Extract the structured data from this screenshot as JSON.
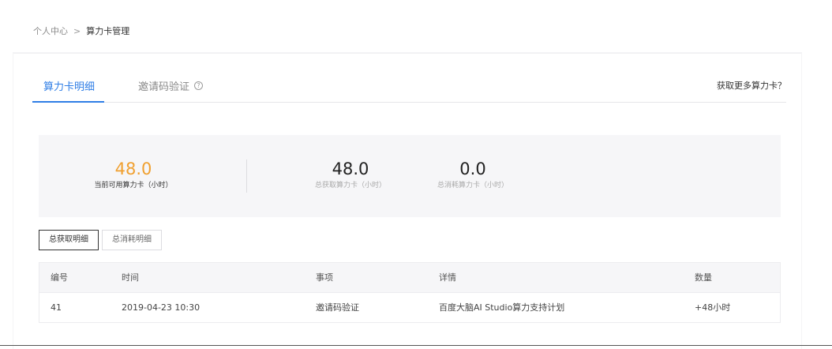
{
  "breadcrumb": {
    "parent": "个人中心",
    "separator": ">",
    "current": "算力卡管理"
  },
  "tabs": {
    "items": [
      {
        "label": "算力卡明细",
        "active": true
      },
      {
        "label": "邀请码验证",
        "active": false
      }
    ],
    "help_icon": "?",
    "more_link": "获取更多算力卡？"
  },
  "stats": {
    "available": {
      "value": "48.0",
      "label": "当前可用算力卡（小时）"
    },
    "total": {
      "value": "48.0",
      "label": "总获取算力卡（小时）"
    },
    "used": {
      "value": "0.0",
      "label": "总消耗算力卡（小时）"
    }
  },
  "subtabs": [
    {
      "label": "总获取明细",
      "active": true
    },
    {
      "label": "总消耗明细",
      "active": false
    }
  ],
  "table": {
    "headers": [
      "编号",
      "时间",
      "事项",
      "详情",
      "数量"
    ],
    "rows": [
      [
        "41",
        "2019-04-23 10:30",
        "邀请码验证",
        "百度大脑AI Studio算力支持计划",
        "+48小时"
      ]
    ]
  },
  "colors": {
    "accent": "#2f7ee6",
    "highlight": "#f0a030"
  }
}
